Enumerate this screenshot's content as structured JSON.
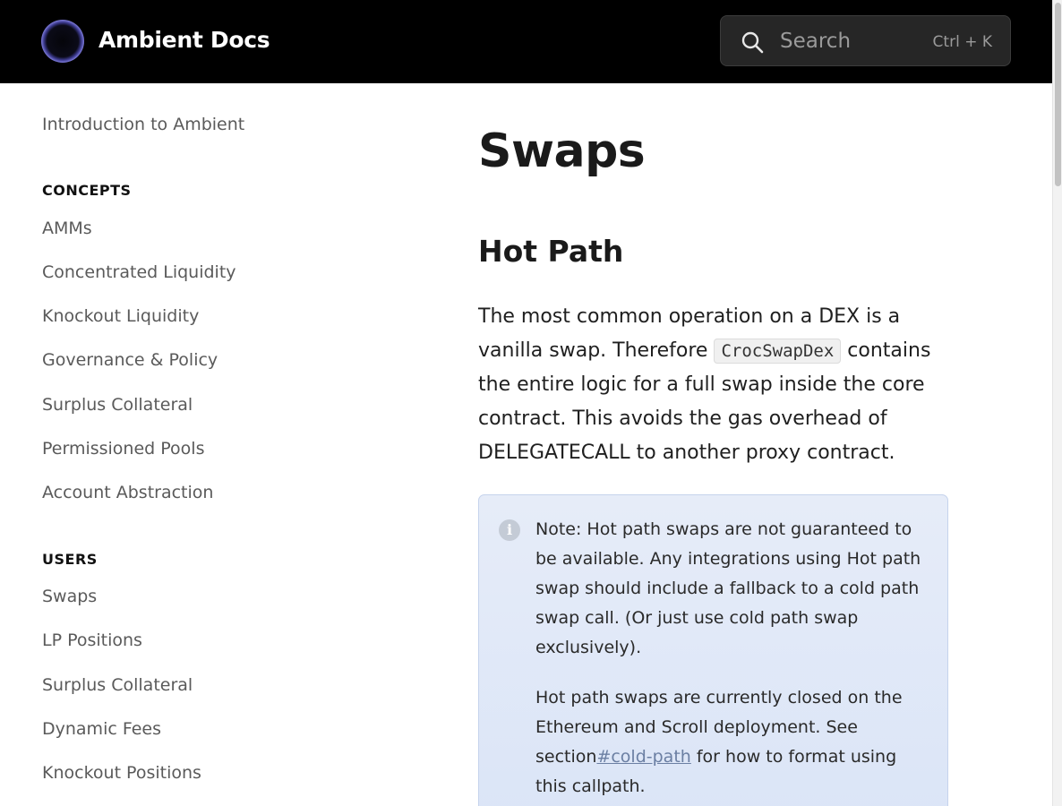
{
  "header": {
    "brand": "Ambient Docs",
    "search": {
      "placeholder": "Search",
      "shortcut": "Ctrl + K"
    }
  },
  "sidebar": {
    "intro": "Introduction to Ambient",
    "sections": [
      {
        "heading": "CONCEPTS",
        "items": [
          "AMMs",
          "Concentrated Liquidity",
          "Knockout Liquidity",
          "Governance & Policy",
          "Surplus Collateral",
          "Permissioned Pools",
          "Account Abstraction"
        ]
      },
      {
        "heading": "USERS",
        "items": [
          "Swaps",
          "LP Positions",
          "Surplus Collateral",
          "Dynamic Fees",
          "Knockout Positions"
        ]
      }
    ]
  },
  "main": {
    "title": "Swaps",
    "section_heading": "Hot Path",
    "paragraph": {
      "before_code": "The most common operation on a DEX is a vanilla swap. Therefore ",
      "code": "CrocSwapDex",
      "after_code": " contains the entire logic for a full swap inside the core contract. This avoids the gas overhead of DELEGATECALL to another proxy contract."
    },
    "callout": {
      "note": "Note: Hot path swaps are not guaranteed to be available. Any integrations using Hot path swap should include a fallback to a cold path swap call. (Or just use cold path swap exclusively).",
      "status_before_link": "Hot path swaps are currently closed on the Ethereum and Scroll deployment. See section",
      "link_text": "#cold-path",
      "status_after_link": " for how to format using this callpath."
    }
  }
}
